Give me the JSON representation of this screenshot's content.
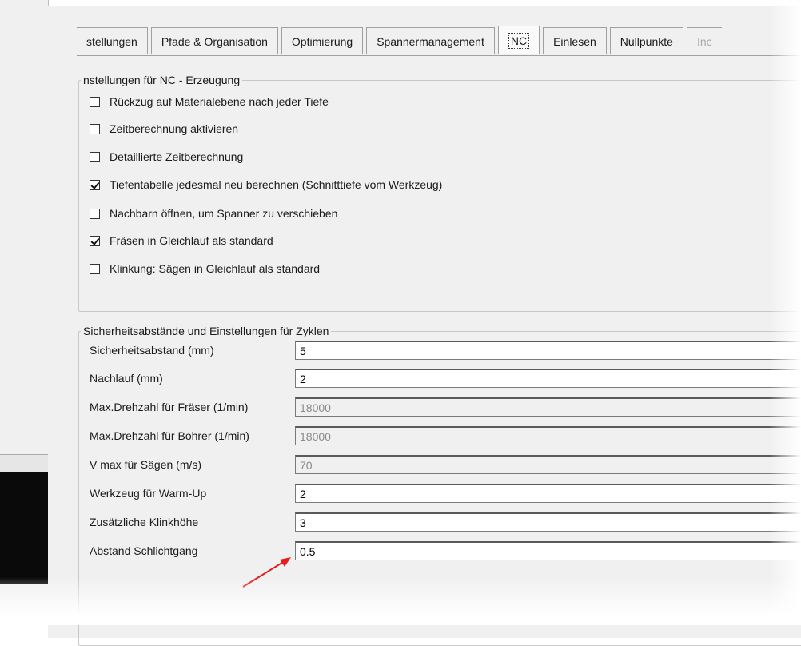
{
  "tabs": [
    {
      "label": "stellungen",
      "state": "normal"
    },
    {
      "label": "Pfade & Organisation",
      "state": "normal"
    },
    {
      "label": "Optimierung",
      "state": "normal"
    },
    {
      "label": "Spannermanagement",
      "state": "normal"
    },
    {
      "label": "NC",
      "state": "active"
    },
    {
      "label": "Einlesen",
      "state": "normal"
    },
    {
      "label": "Nullpunkte",
      "state": "normal"
    },
    {
      "label": "Inc",
      "state": "disabled"
    }
  ],
  "nc_group": {
    "legend": "nstellungen für NC - Erzeugung",
    "options": [
      {
        "label": "Rückzug auf Materialebene nach jeder Tiefe",
        "checked": false
      },
      {
        "label": "Zeitberechnung aktivieren",
        "checked": false
      },
      {
        "label": "Detaillierte Zeitberechnung",
        "checked": false
      },
      {
        "label": "Tiefentabelle jedesmal neu berechnen (Schnitttiefe vom Werkzeug)",
        "checked": true
      },
      {
        "label": "Nachbarn öffnen, um Spanner zu verschieben",
        "checked": false
      },
      {
        "label": "Fräsen in Gleichlauf als standard",
        "checked": true
      },
      {
        "label": "Klinkung: Sägen in Gleichlauf als standard",
        "checked": false
      }
    ]
  },
  "safety_group": {
    "legend": "Sicherheitsabstände und Einstellungen für Zyklen",
    "fields": [
      {
        "label": "Sicherheitsabstand (mm)",
        "value": "5",
        "readonly": false
      },
      {
        "label": "Nachlauf (mm)",
        "value": "2",
        "readonly": false
      },
      {
        "label": "Max.Drehzahl für Fräser (1/min)",
        "value": "18000",
        "readonly": true
      },
      {
        "label": "Max.Drehzahl für Bohrer (1/min)",
        "value": "18000",
        "readonly": true
      },
      {
        "label": "V max für Sägen (m/s)",
        "value": "70",
        "readonly": true
      },
      {
        "label": "Werkzeug für Warm-Up",
        "value": "2",
        "readonly": false
      },
      {
        "label": "Zusätzliche Klinkhöhe",
        "value": "3",
        "readonly": false
      },
      {
        "label": "Abstand Schlichtgang",
        "value": "0.5",
        "readonly": false
      }
    ]
  },
  "annotation": {
    "arrow_color": "#e02020"
  }
}
